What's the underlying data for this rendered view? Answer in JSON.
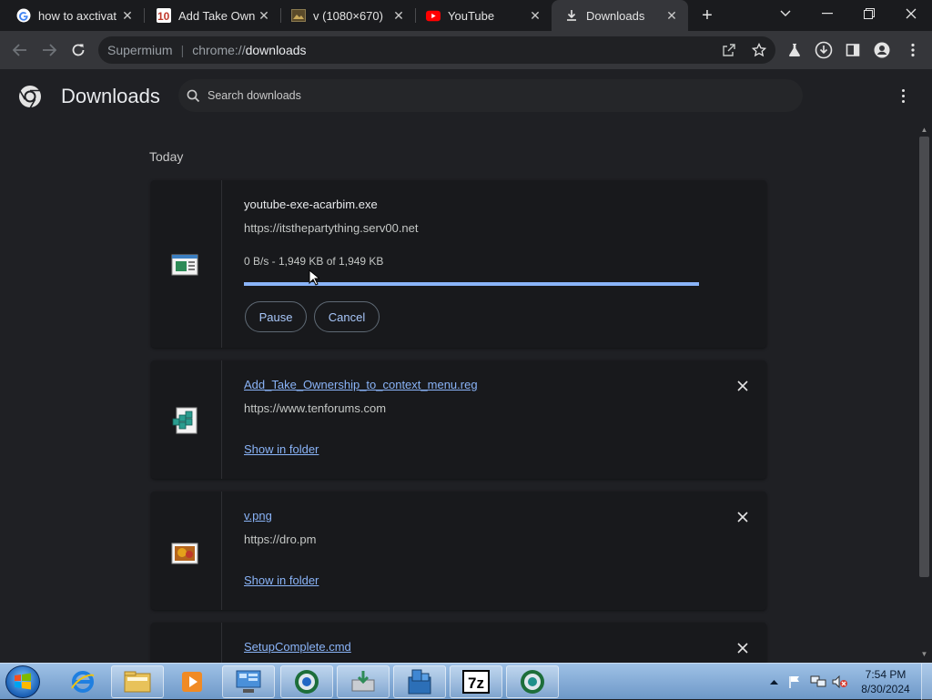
{
  "browser": {
    "tabs": [
      {
        "title": "how to axctivat",
        "favicon": "google-g-icon",
        "active": false
      },
      {
        "title": "Add Take Owne",
        "favicon": "tenforums-icon",
        "active": false
      },
      {
        "title": "v (1080×670)",
        "favicon": "image-file-icon",
        "active": false
      },
      {
        "title": "YouTube",
        "favicon": "youtube-icon",
        "active": false
      },
      {
        "title": "Downloads",
        "favicon": "download-icon",
        "active": true
      }
    ],
    "omnibox": {
      "brand": "Supermium",
      "scheme": "chrome://",
      "host": "downloads"
    }
  },
  "downloads_page": {
    "title": "Downloads",
    "search_placeholder": "Search downloads",
    "day_label": "Today",
    "items": [
      {
        "filename": "youtube-exe-acarbim.exe",
        "url": "https://itsthepartything.serv00.net",
        "status": "0 B/s - 1,949 KB of 1,949 KB",
        "progress_percent": 100,
        "buttons": [
          "Pause",
          "Cancel"
        ],
        "icon": "exe-file-icon"
      },
      {
        "filename": "Add_Take_Ownership_to_context_menu.reg",
        "url": "https://www.tenforums.com",
        "action": "Show in folder",
        "icon": "registry-file-icon"
      },
      {
        "filename": "v.png",
        "url": "https://dro.pm",
        "action": "Show in folder",
        "icon": "image-thumbnail-icon"
      },
      {
        "filename": "SetupComplete.cmd",
        "icon": "cmd-file-icon"
      }
    ]
  },
  "taskbar": {
    "clock_time": "7:54 PM",
    "clock_date": "8/30/2024",
    "apps": [
      "internet-explorer-icon",
      "file-explorer-icon",
      "media-player-icon",
      "control-panel-icon",
      "chrome-browser-icon",
      "installer-icon",
      "file-manager-icon",
      "7zip-icon",
      "chromium-icon"
    ]
  },
  "colors": {
    "accent": "#8ab4f8",
    "page_bg": "#1f2024",
    "card_bg": "#18191c",
    "toolbar": "#35363a"
  }
}
